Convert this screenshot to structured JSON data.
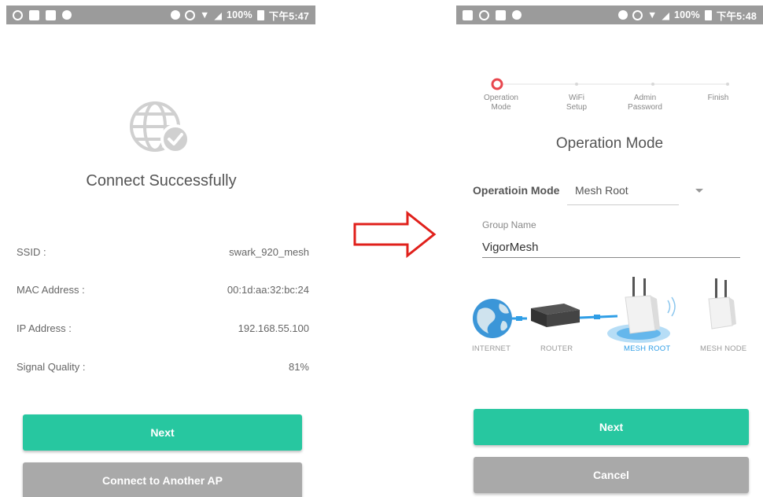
{
  "left": {
    "status_time": "下午5:47",
    "status_battery": "100%",
    "title": "Connect Successfully",
    "rows": [
      {
        "label": "SSID :",
        "value": "swark_920_mesh"
      },
      {
        "label": "MAC Address :",
        "value": "00:1d:aa:32:bc:24"
      },
      {
        "label": "IP Address :",
        "value": "192.168.55.100"
      },
      {
        "label": "Signal Quality :",
        "value": "81%"
      }
    ],
    "next_label": "Next",
    "another_ap_label": "Connect to Another AP"
  },
  "right": {
    "status_time": "下午5:48",
    "status_battery": "100%",
    "steps": [
      "Operation\nMode",
      "WiFi\nSetup",
      "Admin\nPassword",
      "Finish"
    ],
    "title": "Operation Mode",
    "mode_label": "Operatioin Mode",
    "mode_value": "Mesh Root",
    "group_label": "Group Name",
    "group_value": "VigorMesh",
    "topology_labels": [
      "INTERNET",
      "ROUTER",
      "MESH ROOT",
      "MESH NODE"
    ],
    "next_label": "Next",
    "cancel_label": "Cancel"
  },
  "colors": {
    "accent": "#27c7a0",
    "grey_button": "#a9a9a9",
    "arrow": "#e0201b",
    "step_active": "#e8474e",
    "mesh_blue": "#2f9ee6"
  }
}
